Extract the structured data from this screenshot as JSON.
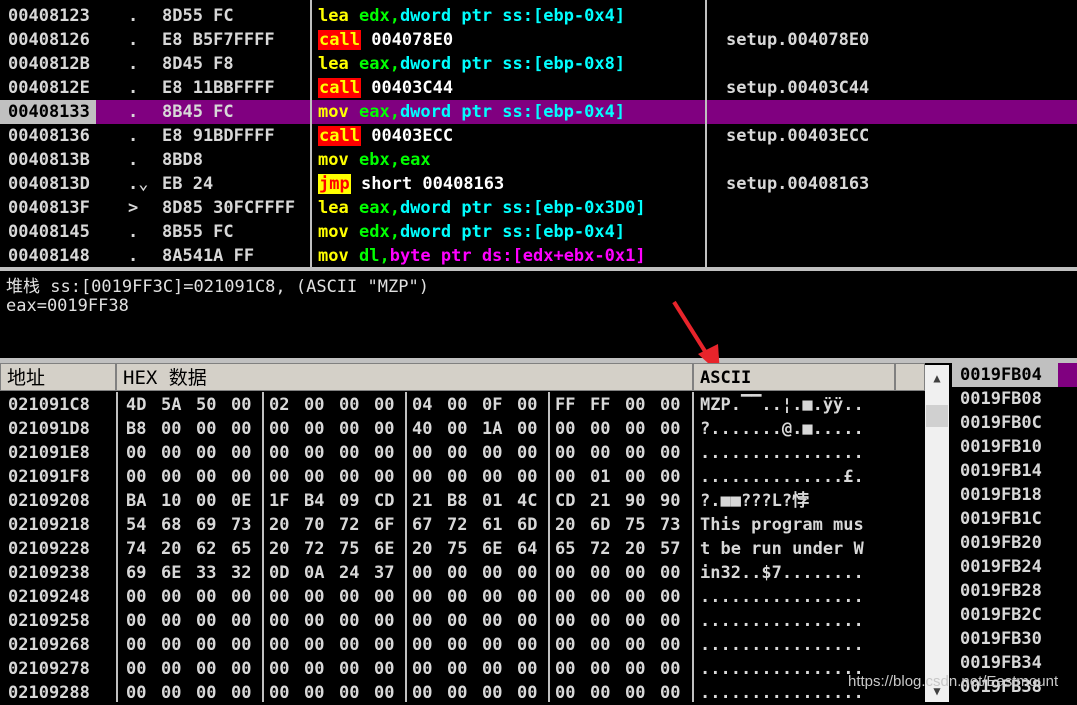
{
  "disasm": {
    "rows": [
      {
        "addr": "00408123",
        "mark": ".",
        "bytes": "8D55 FC",
        "mn": "lea",
        "ops": [
          {
            "t": "edx",
            "c": "#00ff00"
          },
          {
            "t": ",",
            "c": "#00ff00"
          },
          {
            "t": "dword ptr ss:[ebp-0x4]",
            "c": "#00ffff"
          }
        ],
        "comment": ""
      },
      {
        "addr": "00408126",
        "mark": ".",
        "bytes": "E8 B5F7FFFF",
        "mn": "call",
        "ops": [
          {
            "t": "004078E0",
            "c": "#ffffff"
          }
        ],
        "comment": "setup.004078E0"
      },
      {
        "addr": "0040812B",
        "mark": ".",
        "bytes": "8D45 F8",
        "mn": "lea",
        "ops": [
          {
            "t": "eax",
            "c": "#00ff00"
          },
          {
            "t": ",",
            "c": "#00ff00"
          },
          {
            "t": "dword ptr ss:[ebp-0x8]",
            "c": "#00ffff"
          }
        ],
        "comment": ""
      },
      {
        "addr": "0040812E",
        "mark": ".",
        "bytes": "E8 11BBFFFF",
        "mn": "call",
        "ops": [
          {
            "t": "00403C44",
            "c": "#ffffff"
          }
        ],
        "comment": "setup.00403C44"
      },
      {
        "addr": "00408133",
        "mark": ".",
        "bytes": "8B45 FC",
        "mn": "mov",
        "ops": [
          {
            "t": "eax",
            "c": "#00ff00"
          },
          {
            "t": ",",
            "c": "#00ff00"
          },
          {
            "t": "dword ptr ss:[ebp-0x4]",
            "c": "#00ffff"
          }
        ],
        "comment": "",
        "selected": true
      },
      {
        "addr": "00408136",
        "mark": ".",
        "bytes": "E8 91BDFFFF",
        "mn": "call",
        "ops": [
          {
            "t": "00403ECC",
            "c": "#ffffff"
          }
        ],
        "comment": "setup.00403ECC"
      },
      {
        "addr": "0040813B",
        "mark": ".",
        "bytes": "8BD8",
        "mn": "mov",
        "ops": [
          {
            "t": "ebx",
            "c": "#00ff00"
          },
          {
            "t": ",",
            "c": "#00ff00"
          },
          {
            "t": "eax",
            "c": "#00ff00"
          }
        ],
        "comment": ""
      },
      {
        "addr": "0040813D",
        "mark": ".⌄",
        "bytes": "EB 24",
        "mn": "jmp",
        "ops": [
          {
            "t": "short 00408163",
            "c": "#ffffff"
          }
        ],
        "comment": "setup.00408163"
      },
      {
        "addr": "0040813F",
        "mark": ">",
        "bytes": "8D85 30FCFFFF",
        "mn": "lea",
        "ops": [
          {
            "t": "eax",
            "c": "#00ff00"
          },
          {
            "t": ",",
            "c": "#00ff00"
          },
          {
            "t": "dword ptr ss:[ebp-0x3D0]",
            "c": "#00ffff"
          }
        ],
        "comment": ""
      },
      {
        "addr": "00408145",
        "mark": ".",
        "bytes": "8B55 FC",
        "mn": "mov",
        "ops": [
          {
            "t": "edx",
            "c": "#00ff00"
          },
          {
            "t": ",",
            "c": "#00ff00"
          },
          {
            "t": "dword ptr ss:[ebp-0x4]",
            "c": "#00ffff"
          }
        ],
        "comment": ""
      },
      {
        "addr": "00408148",
        "mark": ".",
        "bytes": "8A541A FF",
        "mn": "mov",
        "ops": [
          {
            "t": "dl",
            "c": "#00ff00"
          },
          {
            "t": ",",
            "c": "#00ff00"
          },
          {
            "t": "byte ptr ds:[edx+ebx-0x1]",
            "c": "#ff00ff"
          }
        ],
        "comment": ""
      }
    ]
  },
  "info": {
    "line1": "堆栈 ss:[0019FF3C]=021091C8, (ASCII \"MZP\")",
    "line2": "eax=0019FF38"
  },
  "dump": {
    "headers": {
      "addr": "地址",
      "hex": "HEX 数据",
      "ascii": "ASCII"
    },
    "rows": [
      {
        "addr": "021091C8",
        "hex": [
          "4D",
          "5A",
          "50",
          "00",
          "02",
          "00",
          "00",
          "00",
          "04",
          "00",
          "0F",
          "00",
          "FF",
          "FF",
          "00",
          "00"
        ],
        "ascii": "MZP.▔▔..¦.■.ÿÿ.."
      },
      {
        "addr": "021091D8",
        "hex": [
          "B8",
          "00",
          "00",
          "00",
          "00",
          "00",
          "00",
          "00",
          "40",
          "00",
          "1A",
          "00",
          "00",
          "00",
          "00",
          "00"
        ],
        "ascii": "?.......@.■....."
      },
      {
        "addr": "021091E8",
        "hex": [
          "00",
          "00",
          "00",
          "00",
          "00",
          "00",
          "00",
          "00",
          "00",
          "00",
          "00",
          "00",
          "00",
          "00",
          "00",
          "00"
        ],
        "ascii": "................"
      },
      {
        "addr": "021091F8",
        "hex": [
          "00",
          "00",
          "00",
          "00",
          "00",
          "00",
          "00",
          "00",
          "00",
          "00",
          "00",
          "00",
          "00",
          "01",
          "00",
          "00"
        ],
        "ascii": "..............£."
      },
      {
        "addr": "02109208",
        "hex": [
          "BA",
          "10",
          "00",
          "0E",
          "1F",
          "B4",
          "09",
          "CD",
          "21",
          "B8",
          "01",
          "4C",
          "CD",
          "21",
          "90",
          "90"
        ],
        "ascii": "?.■■???L?悖"
      },
      {
        "addr": "02109218",
        "hex": [
          "54",
          "68",
          "69",
          "73",
          "20",
          "70",
          "72",
          "6F",
          "67",
          "72",
          "61",
          "6D",
          "20",
          "6D",
          "75",
          "73"
        ],
        "ascii": "This program mus"
      },
      {
        "addr": "02109228",
        "hex": [
          "74",
          "20",
          "62",
          "65",
          "20",
          "72",
          "75",
          "6E",
          "20",
          "75",
          "6E",
          "64",
          "65",
          "72",
          "20",
          "57"
        ],
        "ascii": "t be run under W"
      },
      {
        "addr": "02109238",
        "hex": [
          "69",
          "6E",
          "33",
          "32",
          "0D",
          "0A",
          "24",
          "37",
          "00",
          "00",
          "00",
          "00",
          "00",
          "00",
          "00",
          "00"
        ],
        "ascii": "in32..$7........"
      },
      {
        "addr": "02109248",
        "hex": [
          "00",
          "00",
          "00",
          "00",
          "00",
          "00",
          "00",
          "00",
          "00",
          "00",
          "00",
          "00",
          "00",
          "00",
          "00",
          "00"
        ],
        "ascii": "................"
      },
      {
        "addr": "02109258",
        "hex": [
          "00",
          "00",
          "00",
          "00",
          "00",
          "00",
          "00",
          "00",
          "00",
          "00",
          "00",
          "00",
          "00",
          "00",
          "00",
          "00"
        ],
        "ascii": "................"
      },
      {
        "addr": "02109268",
        "hex": [
          "00",
          "00",
          "00",
          "00",
          "00",
          "00",
          "00",
          "00",
          "00",
          "00",
          "00",
          "00",
          "00",
          "00",
          "00",
          "00"
        ],
        "ascii": "................"
      },
      {
        "addr": "02109278",
        "hex": [
          "00",
          "00",
          "00",
          "00",
          "00",
          "00",
          "00",
          "00",
          "00",
          "00",
          "00",
          "00",
          "00",
          "00",
          "00",
          "00"
        ],
        "ascii": "................"
      },
      {
        "addr": "02109288",
        "hex": [
          "00",
          "00",
          "00",
          "00",
          "00",
          "00",
          "00",
          "00",
          "00",
          "00",
          "00",
          "00",
          "00",
          "00",
          "00",
          "00"
        ],
        "ascii": "................"
      }
    ]
  },
  "stack": {
    "rows": [
      "0019FB04",
      "0019FB08",
      "0019FB0C",
      "0019FB10",
      "0019FB14",
      "0019FB18",
      "0019FB1C",
      "0019FB20",
      "0019FB24",
      "0019FB28",
      "0019FB2C",
      "0019FB30",
      "0019FB34",
      "0019FB38"
    ],
    "selected": 0
  },
  "scrollbar": {
    "up": "▲",
    "down": "▼"
  },
  "watermark": "https://blog.csdn.net/Eastmount",
  "colors": {
    "selected_row": "#800080",
    "call_bg": "#ff0000",
    "call_fg": "#ffff00",
    "jmp_bg": "#ffff00",
    "jmp_fg": "#ff0000",
    "mnemonic": "#ffff00",
    "arrow": "#e8242b"
  }
}
